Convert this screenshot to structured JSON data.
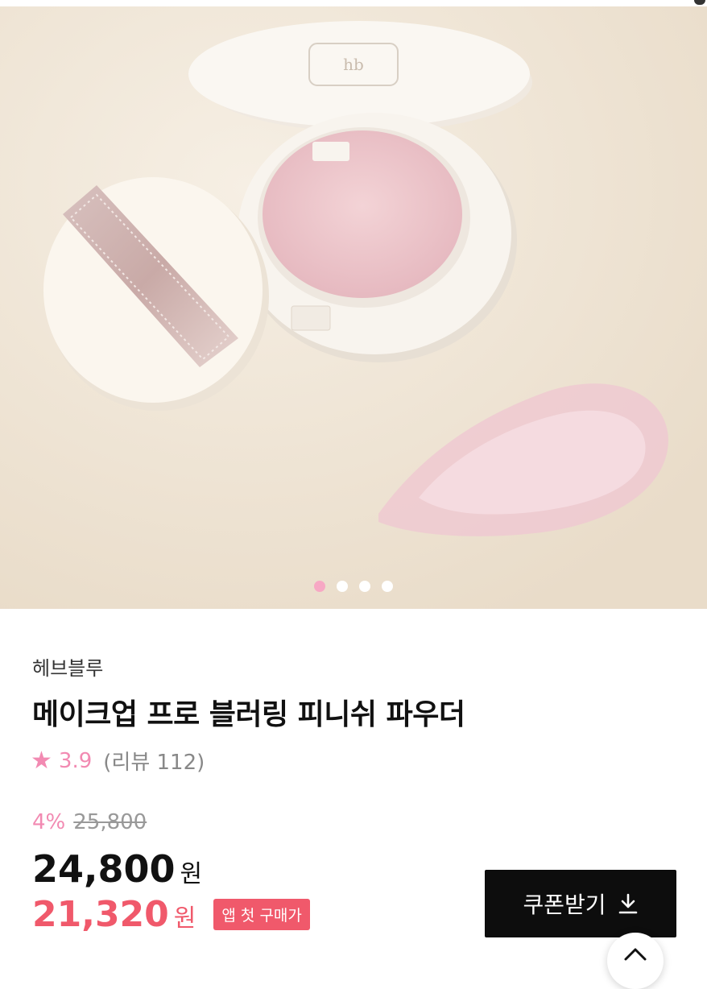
{
  "carousel": {
    "pages": 4,
    "active_index": 0,
    "accent_color": "#f7a8c4"
  },
  "product": {
    "brand": "헤브블루",
    "title": "메이크업 프로 블러링 피니쉬 파우더",
    "rating": {
      "score": "3.9",
      "reviews_text": "(리뷰 112)",
      "star_icon": "star-icon"
    },
    "discount_rate": "4%",
    "original_price": "25,800",
    "price": "24,800",
    "price_unit": "원",
    "app_price": "21,320",
    "app_price_unit": "원",
    "app_badge": "앱 첫 구매가",
    "price_accent_color": "#f0596b"
  },
  "actions": {
    "coupon_label": "쿠폰받기",
    "coupon_icon": "download-icon",
    "scroll_top_icon": "chevron-up-icon"
  }
}
